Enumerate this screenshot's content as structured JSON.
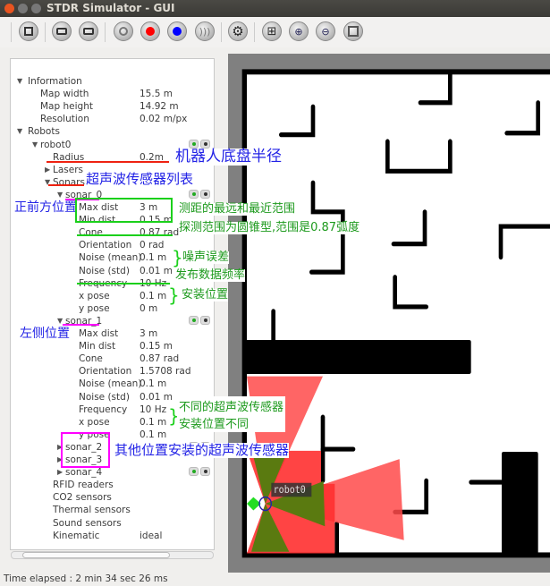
{
  "window": {
    "title": "STDR Simulator - GUI"
  },
  "toolbar": {
    "icons": [
      "load-map-icon",
      "add-robot-icon",
      "load-robot-icon",
      "add-rfid-icon",
      "add-co2-red-icon",
      "add-thermal-blue-icon",
      "add-sound-icon",
      "settings-gear-icon",
      "grid-icon",
      "zoom-in-icon",
      "zoom-out-icon",
      "fullscreen-icon"
    ]
  },
  "tree": [
    {
      "label": "Information",
      "level": 0,
      "arrow": "down"
    },
    {
      "label": "Map width",
      "value": "15.5 m",
      "level": 1
    },
    {
      "label": "Map height",
      "value": "14.92 m",
      "level": 1
    },
    {
      "label": "Resolution",
      "value": "0.02 m/px",
      "level": 1
    },
    {
      "label": "Robots",
      "level": 0,
      "arrow": "down"
    },
    {
      "label": "robot0",
      "level": 1,
      "arrow": "down",
      "eyes": true
    },
    {
      "label": "Radius",
      "value": "0.2m",
      "level": 2
    },
    {
      "label": "Lasers",
      "level": 2,
      "arrow": "right"
    },
    {
      "label": "Sonars",
      "level": 2,
      "arrow": "down"
    },
    {
      "label": "sonar_0",
      "level": 3,
      "arrow": "down",
      "eyes": true
    },
    {
      "label": "Max dist",
      "value": "3 m",
      "level": 4
    },
    {
      "label": "Min dist",
      "value": "0.15 m",
      "level": 4
    },
    {
      "label": "Cone",
      "value": "0.87 rad",
      "level": 4
    },
    {
      "label": "Orientation",
      "value": "0 rad",
      "level": 4
    },
    {
      "label": "Noise (mean)",
      "value": "0.1 m",
      "level": 4
    },
    {
      "label": "Noise (std)",
      "value": "0.01 m",
      "level": 4
    },
    {
      "label": "Frequency",
      "value": "10 Hz",
      "level": 4
    },
    {
      "label": "x pose",
      "value": "0.1 m",
      "level": 4
    },
    {
      "label": "y pose",
      "value": "0 m",
      "level": 4
    },
    {
      "label": "sonar_1",
      "level": 3,
      "arrow": "down",
      "eyes": true
    },
    {
      "label": "Max dist",
      "value": "3 m",
      "level": 4
    },
    {
      "label": "Min dist",
      "value": "0.15 m",
      "level": 4
    },
    {
      "label": "Cone",
      "value": "0.87 rad",
      "level": 4
    },
    {
      "label": "Orientation",
      "value": "1.5708 rad",
      "level": 4
    },
    {
      "label": "Noise (mean)",
      "value": "0.1 m",
      "level": 4
    },
    {
      "label": "Noise (std)",
      "value": "0.01 m",
      "level": 4
    },
    {
      "label": "Frequency",
      "value": "10 Hz",
      "level": 4
    },
    {
      "label": "x pose",
      "value": "0.1 m",
      "level": 4
    },
    {
      "label": "y pose",
      "value": "0.1 m",
      "level": 4
    },
    {
      "label": "sonar_2",
      "level": 3,
      "arrow": "right",
      "eyes": true
    },
    {
      "label": "sonar_3",
      "level": 3,
      "arrow": "right"
    },
    {
      "label": "sonar_4",
      "level": 3,
      "arrow": "right",
      "eyes": true
    },
    {
      "label": "RFID readers",
      "level": 2
    },
    {
      "label": "CO2 sensors",
      "level": 2
    },
    {
      "label": "Thermal sensors",
      "level": 2
    },
    {
      "label": "Sound sensors",
      "level": 2
    },
    {
      "label": "Kinematic",
      "value": "ideal",
      "level": 2
    }
  ],
  "annotations": {
    "radius": "机器人底盘半径",
    "sonar_list": "超声波传感器列表",
    "front": "正前方位置",
    "range": "测距的最远和最近范围",
    "cone": "探测范围为圆锥型,范围是0.87弧度",
    "noise": "噪声误差",
    "frequency": "发布数据频率",
    "pose": "安装位置",
    "left": "左侧位置",
    "diff1": "不同的超声波传感器",
    "diff2": "安装位置不同",
    "others": "其他位置安装的超声波传感器"
  },
  "map": {
    "robot_label": "robot0",
    "colors": {
      "wall": "#000000",
      "sonar_ray": "#ff4040",
      "sonar_hit": "#5a7a10",
      "robot": "#2222aa",
      "frame": "#808080"
    }
  },
  "status": {
    "text": "Time elapsed : 2 min 34 sec 26 ms"
  }
}
